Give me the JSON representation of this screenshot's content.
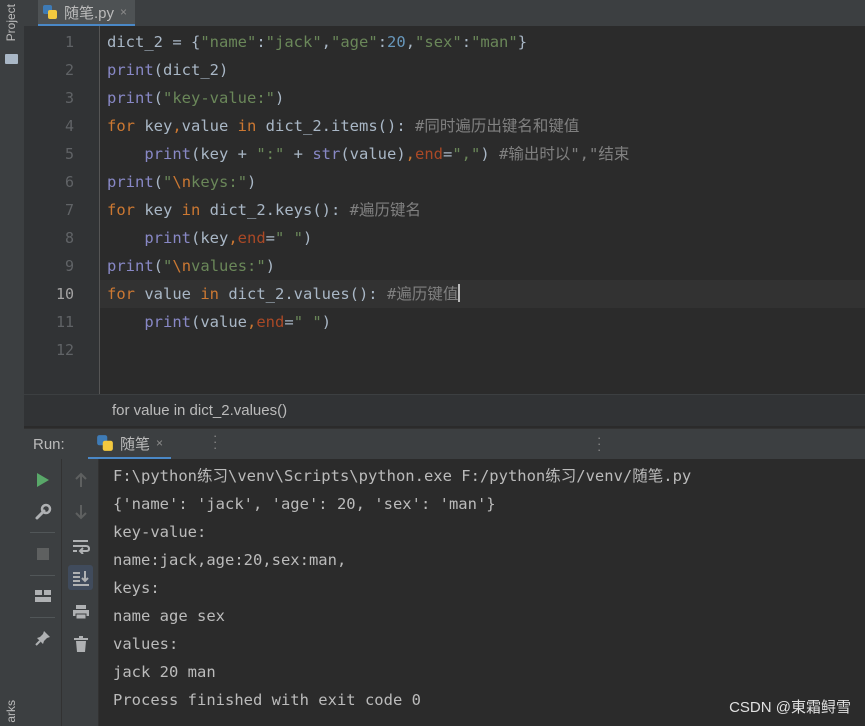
{
  "side_panel": {
    "project_label": "Project",
    "bookmarks_label": "arks"
  },
  "editor_tab": {
    "filename": "随笔.py",
    "close": "×"
  },
  "code": {
    "line_numbers": [
      "1",
      "2",
      "3",
      "4",
      "5",
      "6",
      "7",
      "8",
      "9",
      "10",
      "11",
      "12"
    ],
    "current_line": 10,
    "lines": [
      [
        [
          "plain",
          "dict_2 = {"
        ],
        [
          "str",
          "\"name\""
        ],
        [
          "plain",
          ":"
        ],
        [
          "str",
          "\"jack\""
        ],
        [
          "plain",
          ","
        ],
        [
          "str",
          "\"age\""
        ],
        [
          "plain",
          ":"
        ],
        [
          "num",
          "20"
        ],
        [
          "plain",
          ","
        ],
        [
          "str",
          "\"sex\""
        ],
        [
          "plain",
          ":"
        ],
        [
          "str",
          "\"man\""
        ],
        [
          "plain",
          "}"
        ]
      ],
      [
        [
          "bi",
          "print"
        ],
        [
          "plain",
          "(dict_2)"
        ]
      ],
      [
        [
          "bi",
          "print"
        ],
        [
          "plain",
          "("
        ],
        [
          "str",
          "\"key-value:\""
        ],
        [
          "plain",
          ")"
        ]
      ],
      [
        [
          "kw",
          "for"
        ],
        [
          "plain",
          " key"
        ],
        [
          "kw",
          ","
        ],
        [
          "plain",
          "value "
        ],
        [
          "kw",
          "in"
        ],
        [
          "plain",
          " dict_2.items(): "
        ],
        [
          "cm",
          "#同时遍历出键名和键值"
        ]
      ],
      [
        [
          "plain",
          "    "
        ],
        [
          "bi",
          "print"
        ],
        [
          "plain",
          "(key + "
        ],
        [
          "str",
          "\":\""
        ],
        [
          "plain",
          " + "
        ],
        [
          "bi",
          "str"
        ],
        [
          "plain",
          "(value)"
        ],
        [
          "kw",
          ","
        ],
        [
          "kwa",
          "end"
        ],
        [
          "plain",
          "="
        ],
        [
          "str",
          "\",\""
        ],
        [
          "plain",
          ") "
        ],
        [
          "cm",
          "#输出时以\",\"结束"
        ]
      ],
      [
        [
          "bi",
          "print"
        ],
        [
          "plain",
          "("
        ],
        [
          "str",
          "\""
        ],
        [
          "esc",
          "\\n"
        ],
        [
          "str",
          "keys:\""
        ],
        [
          "plain",
          ")"
        ]
      ],
      [
        [
          "kw",
          "for"
        ],
        [
          "plain",
          " key "
        ],
        [
          "kw",
          "in"
        ],
        [
          "plain",
          " dict_2.keys(): "
        ],
        [
          "cm",
          "#遍历键名"
        ]
      ],
      [
        [
          "plain",
          "    "
        ],
        [
          "bi",
          "print"
        ],
        [
          "plain",
          "(key"
        ],
        [
          "kw",
          ","
        ],
        [
          "kwa",
          "end"
        ],
        [
          "plain",
          "="
        ],
        [
          "str",
          "\" \""
        ],
        [
          "plain",
          ")"
        ]
      ],
      [
        [
          "bi",
          "print"
        ],
        [
          "plain",
          "("
        ],
        [
          "str",
          "\""
        ],
        [
          "esc",
          "\\n"
        ],
        [
          "str",
          "values:\""
        ],
        [
          "plain",
          ")"
        ]
      ],
      [
        [
          "kw",
          "for"
        ],
        [
          "plain",
          " value "
        ],
        [
          "kw",
          "in"
        ],
        [
          "plain",
          " dict_2.values(): "
        ],
        [
          "cm",
          "#遍历键值"
        ],
        [
          "caret",
          ""
        ]
      ],
      [
        [
          "plain",
          "    "
        ],
        [
          "bi",
          "print"
        ],
        [
          "plain",
          "(value"
        ],
        [
          "kw",
          ","
        ],
        [
          "kwa",
          "end"
        ],
        [
          "plain",
          "="
        ],
        [
          "str",
          "\" \""
        ],
        [
          "plain",
          ")"
        ]
      ],
      []
    ]
  },
  "breadcrumb": "for value in dict_2.values()",
  "run_panel": {
    "label": "Run:",
    "tab": "随笔",
    "tab_close": "×",
    "output": [
      "F:\\python练习\\venv\\Scripts\\python.exe F:/python练习/venv/随笔.py",
      "{'name': 'jack', 'age': 20, 'sex': 'man'}",
      "key-value:",
      "name:jack,age:20,sex:man,",
      "keys:",
      "name age sex",
      "values:",
      "jack 20 man",
      "Process finished with exit code 0"
    ]
  },
  "watermark": "CSDN @東霜鲟雪",
  "colors": {
    "keyword": "#cc7832",
    "builtin": "#8888c6",
    "string": "#6a8759",
    "number": "#6897bb",
    "comment": "#808080",
    "kwarg": "#aa4926",
    "run_icon": "#59a869",
    "accent": "#4a88c7"
  },
  "icons": {
    "tools_left": [
      "run-icon",
      "wrench-icon",
      "stop-icon",
      "layout-icon",
      "pin-icon"
    ],
    "tools_right": [
      "arrow-up-icon",
      "arrow-down-icon",
      "soft-wrap-icon",
      "scroll-to-end-icon",
      "print-icon",
      "trash-icon"
    ]
  }
}
